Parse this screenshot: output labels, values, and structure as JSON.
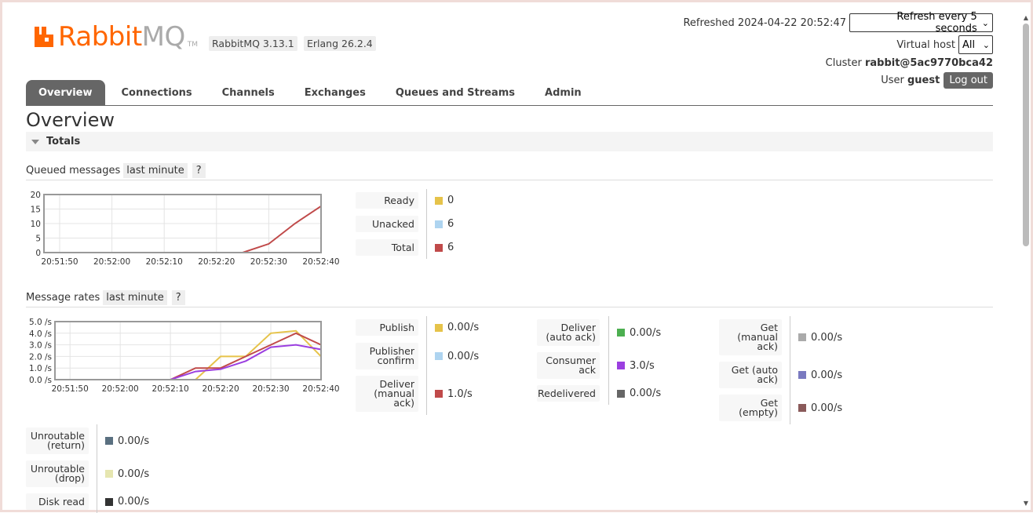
{
  "header": {
    "logo_rabbit": "Rabbit",
    "logo_mq": "MQ",
    "logo_tm": "TM",
    "rabbit_version": "RabbitMQ 3.13.1",
    "erlang_version": "Erlang 26.2.4",
    "refreshed_label": "Refreshed 2024-04-22 20:52:47",
    "refresh_select": "Refresh every 5 seconds",
    "vhost_label": "Virtual host",
    "vhost_select": "All",
    "cluster_label": "Cluster",
    "cluster_name": "rabbit@5ac9770bca42",
    "user_label": "User",
    "user_name": "guest",
    "logout": "Log out"
  },
  "tabs": [
    "Overview",
    "Connections",
    "Channels",
    "Exchanges",
    "Queues and Streams",
    "Admin"
  ],
  "page_title": "Overview",
  "totals_section": "Totals",
  "queued": {
    "title": "Queued messages",
    "range": "last minute",
    "help": "?",
    "legend": [
      {
        "label": "Ready",
        "value": "0",
        "color": "#e6c34a"
      },
      {
        "label": "Unacked",
        "value": "6",
        "color": "#aed4f0"
      },
      {
        "label": "Total",
        "value": "6",
        "color": "#c04a4a"
      }
    ]
  },
  "rates": {
    "title": "Message rates",
    "range": "last minute",
    "help": "?",
    "col1": [
      {
        "label": "Publish",
        "value": "0.00/s",
        "color": "#e6c34a"
      },
      {
        "label": "Publisher confirm",
        "value": "0.00/s",
        "color": "#aed4f0"
      },
      {
        "label": "Deliver (manual ack)",
        "value": "1.0/s",
        "color": "#c04a4a"
      }
    ],
    "col2": [
      {
        "label": "Deliver (auto ack)",
        "value": "0.00/s",
        "color": "#4caf50"
      },
      {
        "label": "Consumer ack",
        "value": "3.0/s",
        "color": "#9b3fe0"
      },
      {
        "label": "Redelivered",
        "value": "0.00/s",
        "color": "#666666"
      }
    ],
    "col3": [
      {
        "label": "Get (manual ack)",
        "value": "0.00/s",
        "color": "#aaaaaa"
      },
      {
        "label": "Get (auto ack)",
        "value": "0.00/s",
        "color": "#7a7ac0"
      },
      {
        "label": "Get (empty)",
        "value": "0.00/s",
        "color": "#8a5a5a"
      }
    ],
    "col0": [
      {
        "label": "Unroutable (return)",
        "value": "0.00/s",
        "color": "#5a7080"
      },
      {
        "label": "Unroutable (drop)",
        "value": "0.00/s",
        "color": "#e6e6b0"
      },
      {
        "label": "Disk read",
        "value": "0.00/s",
        "color": "#333333"
      }
    ]
  },
  "chart_data": [
    {
      "type": "line",
      "title": "Queued messages",
      "x": [
        "20:51:50",
        "20:52:00",
        "20:52:10",
        "20:52:20",
        "20:52:30",
        "20:52:40"
      ],
      "ylim": [
        0,
        20
      ],
      "yticks": [
        "0",
        "5",
        "10",
        "15",
        "20"
      ],
      "series_x": [
        -10,
        -5,
        0,
        5,
        10,
        15,
        20,
        25,
        30,
        35,
        40,
        45
      ],
      "series": [
        {
          "name": "Ready",
          "color": "#e6c34a",
          "values": [
            0,
            0,
            0,
            0,
            0,
            0,
            0,
            0,
            0,
            0,
            0,
            0
          ]
        },
        {
          "name": "Total",
          "color": "#c04a4a",
          "values": [
            0,
            0,
            0,
            0,
            0,
            0,
            0,
            0,
            3,
            10,
            16,
            16
          ]
        }
      ]
    },
    {
      "type": "line",
      "title": "Message rates",
      "x": [
        "20:51:50",
        "20:52:00",
        "20:52:10",
        "20:52:20",
        "20:52:30",
        "20:52:40"
      ],
      "ylim": [
        0,
        5
      ],
      "yticks": [
        "0.0 /s",
        "1.0 /s",
        "2.0 /s",
        "3.0 /s",
        "4.0 /s",
        "5.0 /s"
      ],
      "series_x": [
        -10,
        -5,
        0,
        5,
        10,
        15,
        20,
        25,
        30,
        35,
        40
      ],
      "series": [
        {
          "name": "Publish",
          "color": "#e6c34a",
          "values": [
            0,
            0,
            0,
            0,
            0,
            0,
            2,
            2,
            4,
            4.2,
            2,
            0
          ]
        },
        {
          "name": "Deliver (manual ack)",
          "color": "#c04a4a",
          "values": [
            0,
            0,
            0,
            0,
            0,
            1,
            1,
            2,
            3,
            4,
            3,
            1
          ]
        },
        {
          "name": "Consumer ack",
          "color": "#9b3fe0",
          "values": [
            0,
            0,
            0,
            0,
            0,
            0.7,
            0.9,
            1.6,
            2.8,
            3,
            2.6,
            3
          ]
        }
      ]
    }
  ]
}
